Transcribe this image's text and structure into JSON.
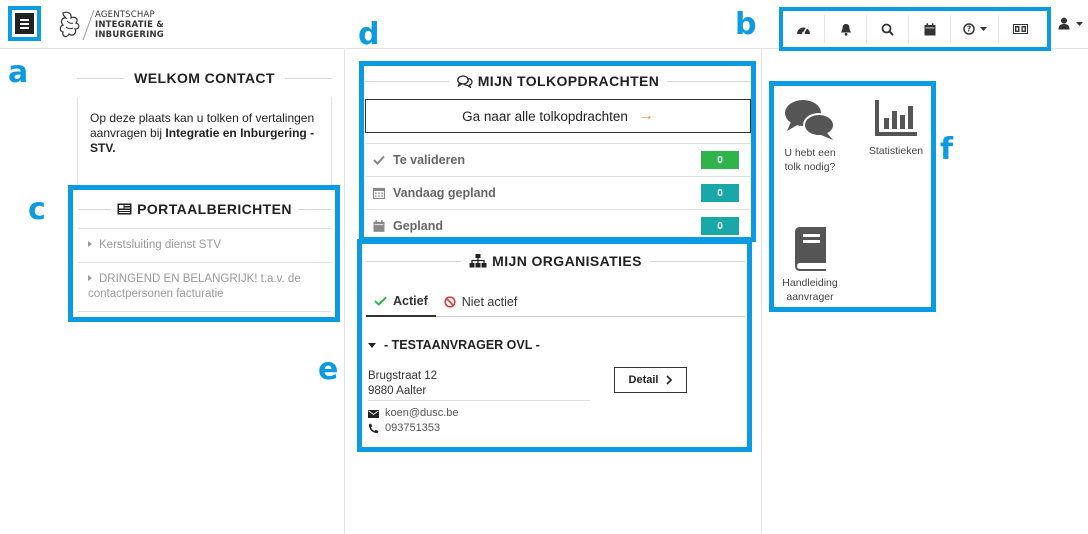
{
  "header": {
    "logo": {
      "line1": "AGENTSCHAP",
      "line2": "INTEGRATIE &",
      "line3": "INBURGERING"
    },
    "toolbar": [
      {
        "icon": "dashboard-icon"
      },
      {
        "icon": "bell-icon"
      },
      {
        "icon": "search-icon"
      },
      {
        "icon": "calendar-icon"
      },
      {
        "icon": "help-icon",
        "dropdown": true
      },
      {
        "icon": "language-icon"
      }
    ],
    "user": {
      "icon": "user-icon"
    }
  },
  "annotations": {
    "a": "a",
    "b": "b",
    "c": "c",
    "d": "d",
    "e": "e",
    "f": "f"
  },
  "welcome": {
    "title": "WELKOM CONTACT",
    "text_pre": "Op deze plaats kan u tolken of vertalingen aanvragen bij ",
    "text_bold": "Integratie en Inburgering - STV."
  },
  "portaal": {
    "title": "PORTAALBERICHTEN",
    "items": [
      "Kerstsluiting dienst STV",
      "DRINGEND EN BELANGRIJK! t.a.v. de contactpersonen facturatie"
    ]
  },
  "tolk": {
    "title": "MIJN TOLKOPDRACHTEN",
    "goto_label": "Ga naar alle tolkopdrachten",
    "rows": [
      {
        "label": "Te valideren",
        "count": "0",
        "icon": "check-icon",
        "color": "#2fb34a"
      },
      {
        "label": "Vandaag gepland",
        "count": "0",
        "icon": "calendar-grid-icon",
        "color": "#1aa7a7"
      },
      {
        "label": "Gepland",
        "count": "0",
        "icon": "calendar-icon",
        "color": "#1aa7a7"
      }
    ]
  },
  "org": {
    "title": "MIJN ORGANISATIES",
    "tab_active": "Actief",
    "tab_inactive": "Niet actief",
    "name": "- TESTAANVRAGER OVL -",
    "street": "Brugstraat 12",
    "city": "9880 Aalter",
    "email": "koen@dusc.be",
    "phone": "093751353",
    "detail_label": "Detail"
  },
  "tiles": [
    {
      "label": "U hebt een tolk nodig?",
      "icon": "chat-bubbles-icon"
    },
    {
      "label": "Statistieken",
      "icon": "bar-chart-icon"
    },
    {
      "label": "Handleiding aanvrager",
      "icon": "book-icon"
    }
  ],
  "colors": {
    "accent": "#0b9be3",
    "green": "#2fb34a",
    "teal": "#1aa7a7",
    "orange": "#e8962f"
  }
}
